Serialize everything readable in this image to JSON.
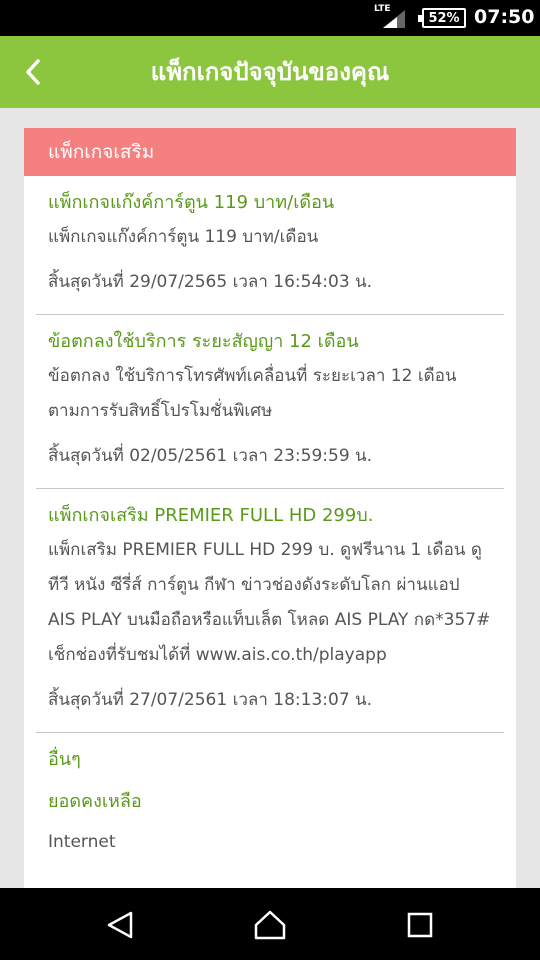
{
  "status_bar": {
    "network": "LTE",
    "battery": "52%",
    "time": "07:50"
  },
  "app_bar": {
    "title": "แพ็กเกจปัจจุบันของคุณ"
  },
  "card": {
    "header": "แพ็กเกจเสริม",
    "packages": [
      {
        "name": "แพ็กเกจแก๊งค์การ์ตูน 119 บาท/เดือน",
        "description": "แพ็กเกจแก๊งค์การ์ตูน 119 บาท/เดือน",
        "expiry": "สิ้นสุดวันที่ 29/07/2565 เวลา 16:54:03 น."
      },
      {
        "name": "ข้อตกลงใช้บริการ ระยะสัญญา 12 เดือน",
        "description": "ข้อตกลง ใช้บริการโทรศัพท์เคลื่อนที่ ระยะเวลา 12 เดือน ตามการรับสิทธิ์โปรโมชั่นพิเศษ",
        "expiry": "สิ้นสุดวันที่ 02/05/2561 เวลา 23:59:59 น."
      },
      {
        "name": "แพ็กเกจเสริม PREMIER FULL HD 299บ.",
        "description": "แพ็กเสริม PREMIER FULL HD 299 บ. ดูฟรีนาน 1 เดือน ดูทีวี หนัง ซีรี่ส์ การ์ตูน กีฬา ข่าวช่องดังระดับโลก ผ่านแอป AIS PLAY บนมือถือหรือแท็บเล็ต โหลด AIS PLAY กด*357# เช็กช่องที่รับชมได้ที่ www.ais.co.th/playapp",
        "expiry": "สิ้นสุดวันที่ 27/07/2561 เวลา 18:13:07 น."
      }
    ],
    "others": {
      "heading": "อื่นๆ",
      "balance_label": "ยอดคงเหลือ",
      "internet_label": "Internet"
    }
  },
  "icons": {
    "back": "chevron-left-icon",
    "nav_back": "triangle-back-icon",
    "nav_home": "home-icon",
    "nav_recents": "square-recents-icon"
  },
  "colors": {
    "app_bar": "#8cc63f",
    "card_header": "#f48080",
    "package_name": "#5a9a1a",
    "background": "#e6e6e6"
  }
}
